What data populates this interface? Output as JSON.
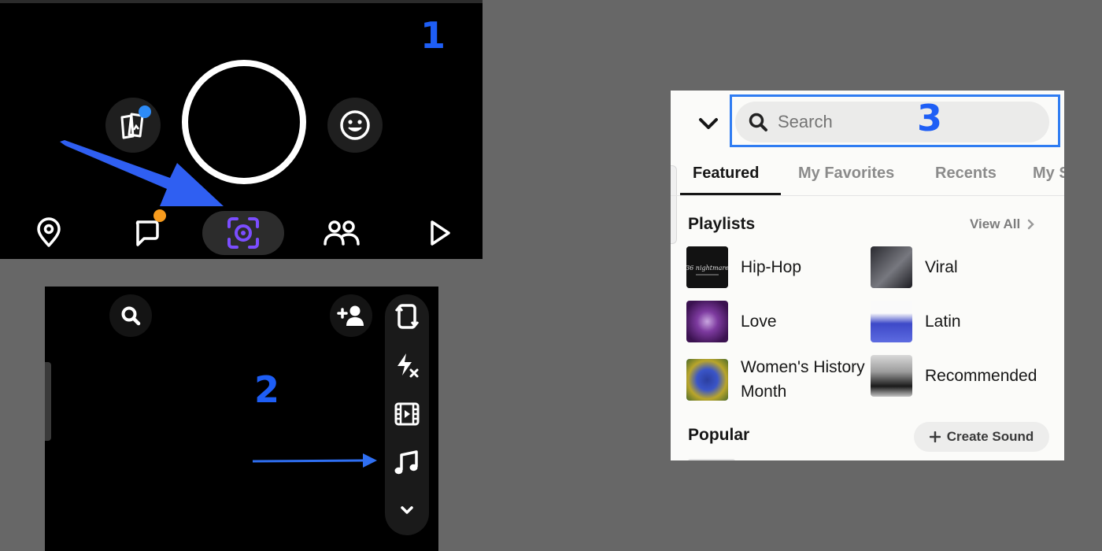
{
  "step_numbers": {
    "one": "1",
    "two": "2",
    "three": "3"
  },
  "camera_screen": {
    "memories_icon": "memories-cards-icon",
    "lens_icon": "smiley-face-icon",
    "nav": [
      "map-pin-icon",
      "chat-bubble-icon",
      "camera-scan-icon",
      "friends-icon",
      "play-icon"
    ],
    "colors": {
      "active_nav": "#7b4dff",
      "badge_blue": "#2d8bf7",
      "badge_orange": "#f79b1d",
      "annotation": "#2f5ff2"
    }
  },
  "camera_toolbar": {
    "tools": [
      "flip-camera-icon",
      "flash-off-icon",
      "video-mode-icon",
      "music-note-icon",
      "chevron-down-icon"
    ]
  },
  "sounds_panel": {
    "search": {
      "placeholder": "Search"
    },
    "tabs": [
      "Featured",
      "My Favorites",
      "Recents",
      "My S"
    ],
    "playlists_title": "Playlists",
    "view_all": "View All",
    "playlists": [
      {
        "label": "Hip-Hop"
      },
      {
        "label": "Viral"
      },
      {
        "label": "Love"
      },
      {
        "label": "Latin"
      },
      {
        "label": "Women's History Month"
      },
      {
        "label": "Recommended"
      }
    ],
    "popular_title": "Popular",
    "create_sound": "Create Sound",
    "thumb_art_text": "36 nightmare",
    "colors": {
      "highlight": "#2f7cf2"
    }
  }
}
